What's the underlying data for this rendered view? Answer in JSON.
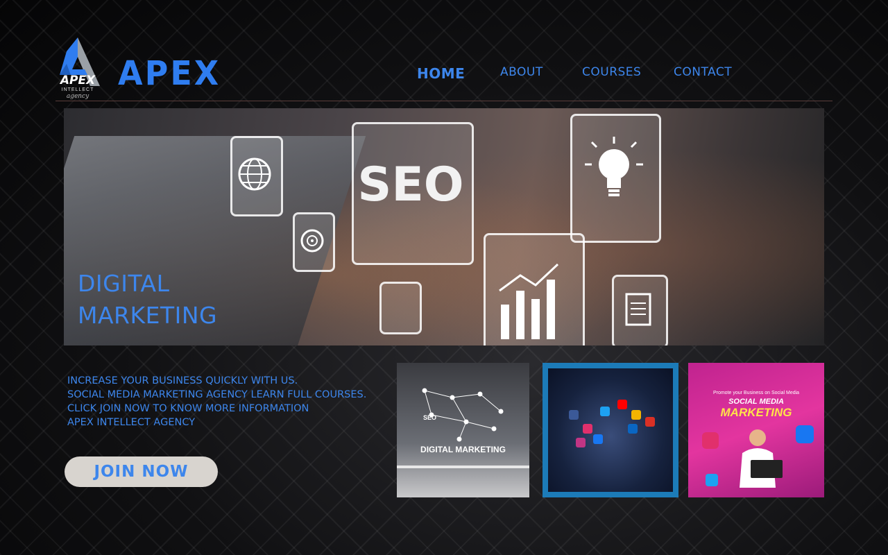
{
  "brand": {
    "logo_text": "APEX",
    "logo_sub": "INTELLECT",
    "logo_script": "agency",
    "name": "APEX"
  },
  "nav": {
    "items": [
      {
        "label": "HOME",
        "active": true
      },
      {
        "label": "ABOUT"
      },
      {
        "label": "COURSES"
      },
      {
        "label": "CONTACT"
      }
    ]
  },
  "hero": {
    "badge_text": "SEO",
    "title_line1": "DIGITAL",
    "title_line2": "MARKETING"
  },
  "info": {
    "lines": [
      "INCREASE YOUR BUSINESS QUICKLY WITH US.",
      "SOCIAL MEDIA MARKETING AGENCY LEARN FULL COURSES.",
      "CLICK JOIN NOW TO KNOW MORE INFORMATION",
      "APEX INTELLECT AGENCY"
    ]
  },
  "cta": {
    "label": "JOIN NOW"
  },
  "thumbnails": [
    {
      "caption": "DIGITAL MARKETING",
      "seo": "SEO"
    },
    {
      "caption": ""
    },
    {
      "promo": "Promote your Business on Social Media",
      "title1": "SOCIAL MEDIA",
      "title2": "MARKETING"
    }
  ],
  "colors": {
    "accent": "#3d86ec",
    "button_bg": "#d8d4cf",
    "rule": "#5a3d3a",
    "promo_bg": "#e3359f"
  }
}
